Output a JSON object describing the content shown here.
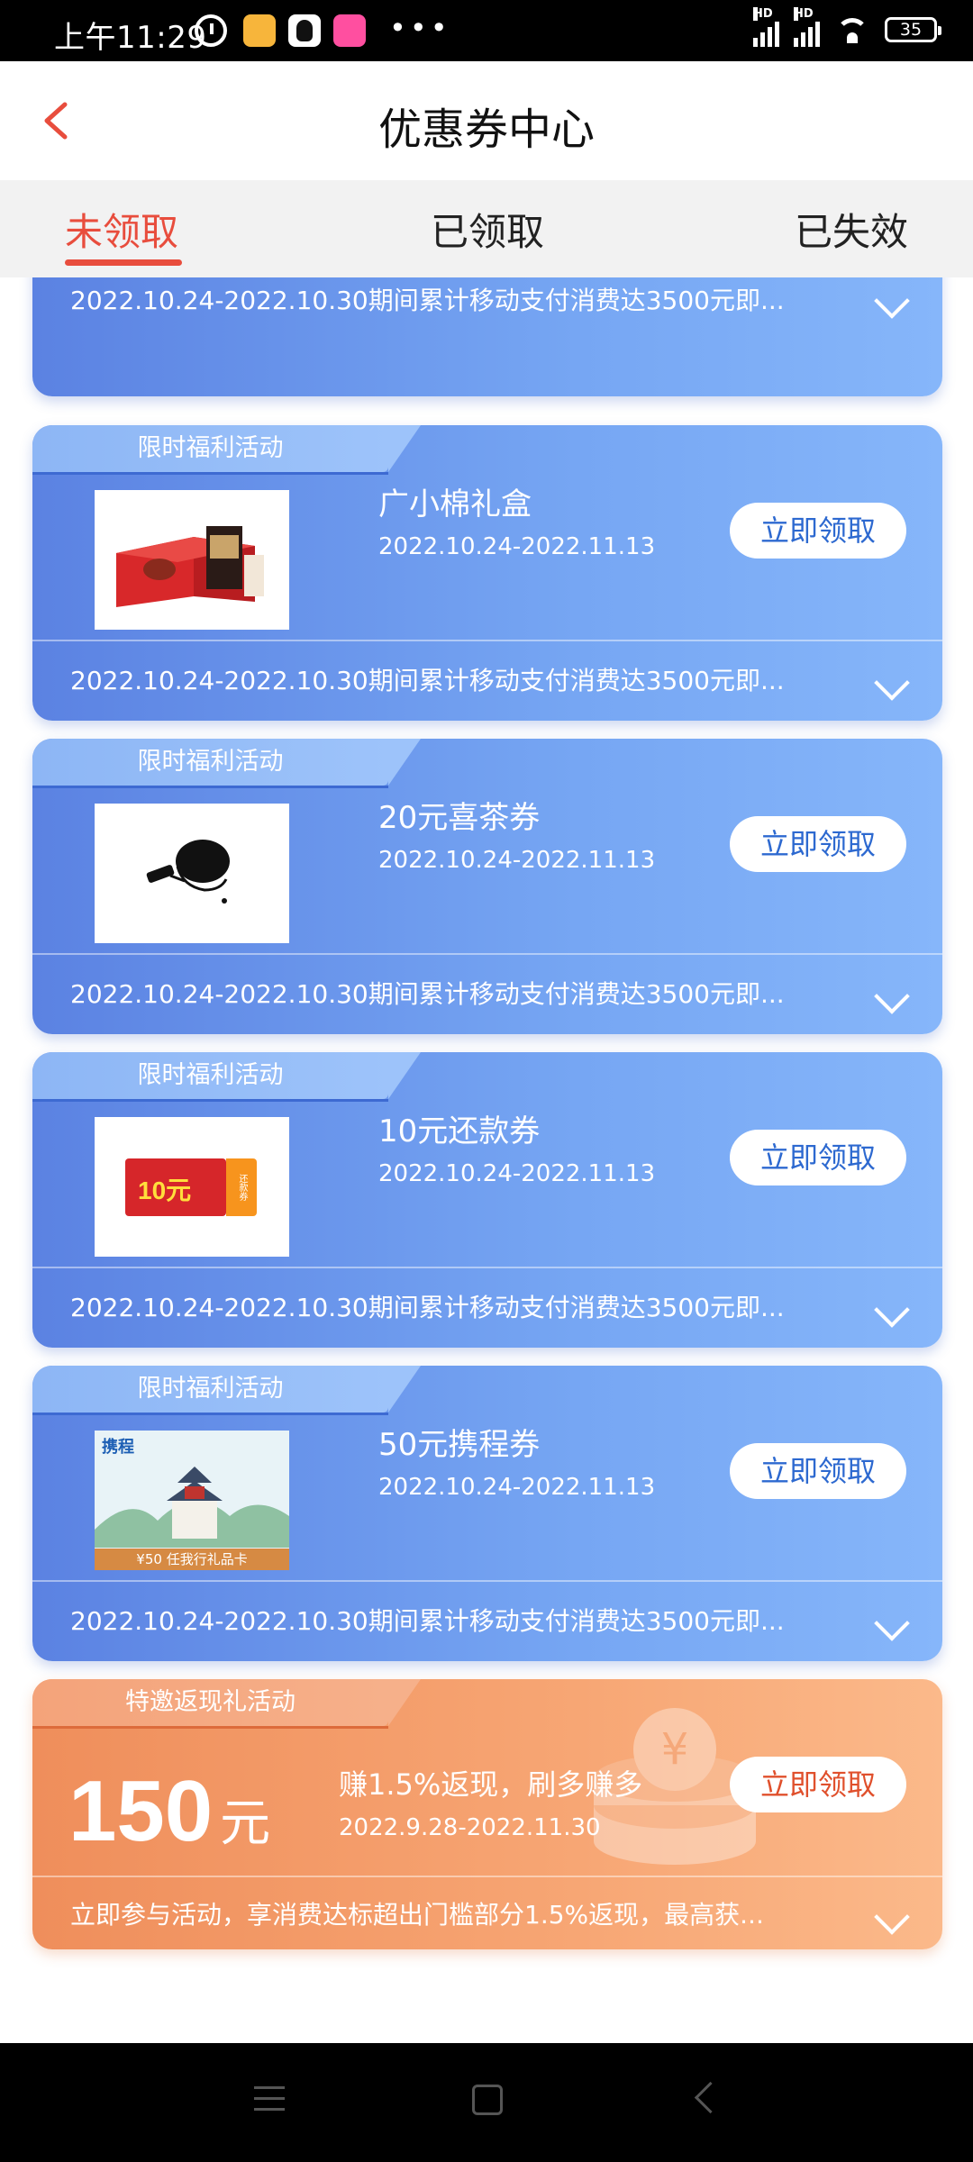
{
  "status_bar": {
    "time": "上午11:29",
    "network_label": "HD",
    "battery": "35"
  },
  "header": {
    "title": "优惠券中心"
  },
  "tabs": [
    {
      "label": "未领取",
      "active": true
    },
    {
      "label": "已领取",
      "active": false
    },
    {
      "label": "已失效",
      "active": false
    }
  ],
  "cards": [
    {
      "ribbon": "",
      "title": "",
      "date": "",
      "button": "",
      "description": "2022.10.24-2022.10.30期间累计移动支付消费达3500元即..."
    },
    {
      "ribbon": "限时福利活动",
      "title": "广小棉礼盒",
      "date": "2022.10.24-2022.11.13",
      "button": "立即领取",
      "description": "2022.10.24-2022.10.30期间累计移动支付消费达3500元即..."
    },
    {
      "ribbon": "限时福利活动",
      "title": "20元喜茶券",
      "date": "2022.10.24-2022.11.13",
      "button": "立即领取",
      "description": "2022.10.24-2022.10.30期间累计移动支付消费达3500元即..."
    },
    {
      "ribbon": "限时福利活动",
      "title": "10元还款券",
      "date": "2022.10.24-2022.11.13",
      "button": "立即领取",
      "description": "2022.10.24-2022.10.30期间累计移动支付消费达3500元即...",
      "thumb_amount": "10元",
      "thumb_tag": "还款券"
    },
    {
      "ribbon": "限时福利活动",
      "title": "50元携程券",
      "date": "2022.10.24-2022.11.13",
      "button": "立即领取",
      "description": "2022.10.24-2022.10.30期间累计移动支付消费达3500元即...",
      "thumb_brand": "携程",
      "thumb_caption": "¥50 任我行礼品卡"
    }
  ],
  "promo_card": {
    "ribbon": "特邀返现礼活动",
    "amount": "150",
    "unit": "元",
    "title": "赚1.5%返现，刷多赚多",
    "date": "2022.9.28-2022.11.30",
    "button": "立即领取",
    "description": "立即参与活动，享消费达标超出门槛部分1.5%返现，最高获..."
  },
  "colors": {
    "accent_red": "#e84d3d",
    "card_blue": "#6a95ec",
    "card_orange": "#f4a06c"
  }
}
